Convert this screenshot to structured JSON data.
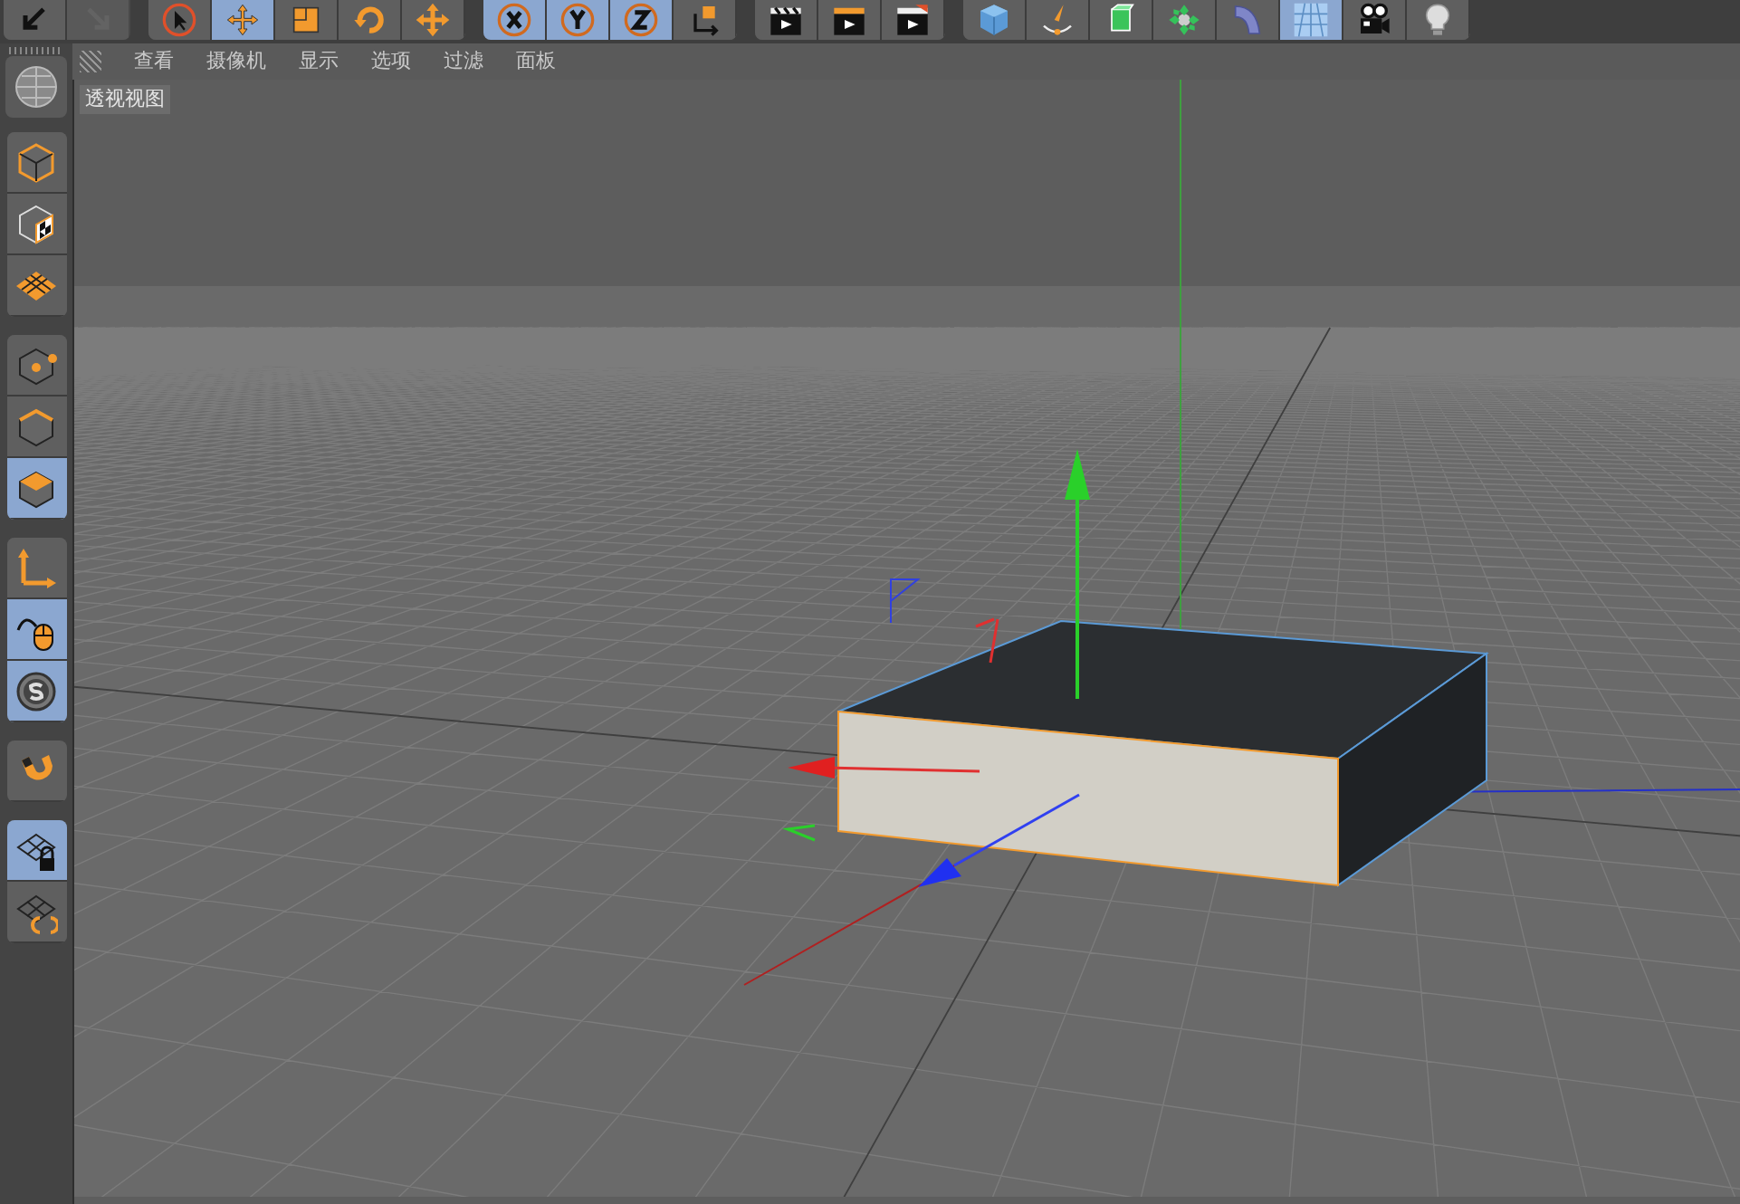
{
  "toolbar": {
    "groups": [
      [
        {
          "kind": "undo",
          "selected": false,
          "disabled": false
        },
        {
          "kind": "redo",
          "selected": false,
          "disabled": true
        }
      ],
      [
        {
          "kind": "live-select",
          "selected": false,
          "disabled": false
        },
        {
          "kind": "move",
          "selected": true,
          "disabled": false
        },
        {
          "kind": "scale",
          "selected": false,
          "disabled": false
        },
        {
          "kind": "rotate",
          "selected": false,
          "disabled": false
        },
        {
          "kind": "recent",
          "selected": false,
          "disabled": false
        }
      ],
      [
        {
          "kind": "x-axis",
          "selected": true,
          "disabled": false
        },
        {
          "kind": "y-axis",
          "selected": true,
          "disabled": false
        },
        {
          "kind": "z-axis",
          "selected": true,
          "disabled": false
        },
        {
          "kind": "coord-system",
          "selected": false,
          "disabled": false
        }
      ],
      [
        {
          "kind": "render-view",
          "selected": false,
          "disabled": false
        },
        {
          "kind": "render",
          "selected": false,
          "disabled": false
        },
        {
          "kind": "render-settings",
          "selected": false,
          "disabled": false
        }
      ],
      [
        {
          "kind": "cube",
          "selected": false,
          "disabled": false
        },
        {
          "kind": "pen",
          "selected": false,
          "disabled": false
        },
        {
          "kind": "subdivision",
          "selected": false,
          "disabled": false
        },
        {
          "kind": "array",
          "selected": false,
          "disabled": false
        },
        {
          "kind": "bend",
          "selected": false,
          "disabled": false
        },
        {
          "kind": "floor",
          "selected": true,
          "disabled": false
        },
        {
          "kind": "camera",
          "selected": false,
          "disabled": false
        },
        {
          "kind": "light",
          "selected": false,
          "disabled": false
        }
      ]
    ]
  },
  "menu": [
    "查看",
    "摄像机",
    "显示",
    "选项",
    "过滤",
    "面板"
  ],
  "viewport": {
    "label": "透视视图"
  },
  "sidebar": {
    "groups": [
      [
        {
          "kind": "model",
          "selected": false
        },
        {
          "kind": "texture",
          "selected": false
        },
        {
          "kind": "workplane",
          "selected": false
        }
      ],
      [
        {
          "kind": "points",
          "selected": false
        },
        {
          "kind": "edges",
          "selected": false
        },
        {
          "kind": "polygons",
          "selected": true
        }
      ],
      [
        {
          "kind": "axis",
          "selected": false
        },
        {
          "kind": "tweak",
          "selected": true
        },
        {
          "kind": "snap",
          "selected": true
        }
      ],
      [
        {
          "kind": "magnet",
          "selected": false
        }
      ],
      [
        {
          "kind": "lock-workplane",
          "selected": true
        },
        {
          "kind": "workplane-sync",
          "selected": false
        }
      ]
    ]
  }
}
